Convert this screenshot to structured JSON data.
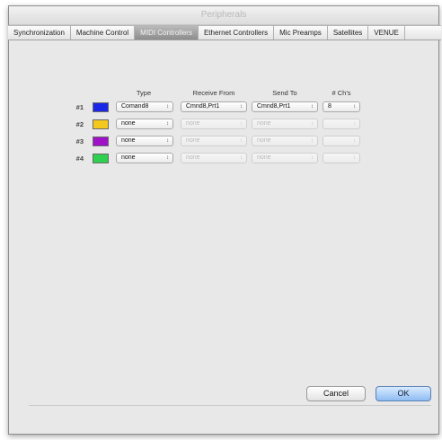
{
  "window": {
    "title": "Peripherals"
  },
  "tabs": [
    {
      "label": "Synchronization",
      "active": false
    },
    {
      "label": "Machine Control",
      "active": false
    },
    {
      "label": "MIDI Controllers",
      "active": true
    },
    {
      "label": "Ethernet Controllers",
      "active": false
    },
    {
      "label": "Mic Preamps",
      "active": false
    },
    {
      "label": "Satellites",
      "active": false
    },
    {
      "label": "VENUE",
      "active": false
    }
  ],
  "table": {
    "headers": {
      "type": "Type",
      "receive": "Receive From",
      "send": "Send To",
      "channels": "# Ch's"
    },
    "rows": [
      {
        "label": "#1",
        "color": "#1a27e6",
        "type": "Comand8",
        "receive": "Cmnd8,Prt1",
        "send": "Cmnd8,Prt1",
        "channels": "8",
        "enabled": true
      },
      {
        "label": "#2",
        "color": "#f5c81e",
        "type": "none",
        "receive": "none",
        "send": "none",
        "channels": "",
        "enabled": false
      },
      {
        "label": "#3",
        "color": "#a012c8",
        "type": "none",
        "receive": "none",
        "send": "none",
        "channels": "",
        "enabled": false
      },
      {
        "label": "#4",
        "color": "#2fcf4f",
        "type": "none",
        "receive": "none",
        "send": "none",
        "channels": "",
        "enabled": false
      }
    ],
    "popup_arrow_glyph": "↕"
  },
  "buttons": {
    "cancel": "Cancel",
    "ok": "OK"
  }
}
